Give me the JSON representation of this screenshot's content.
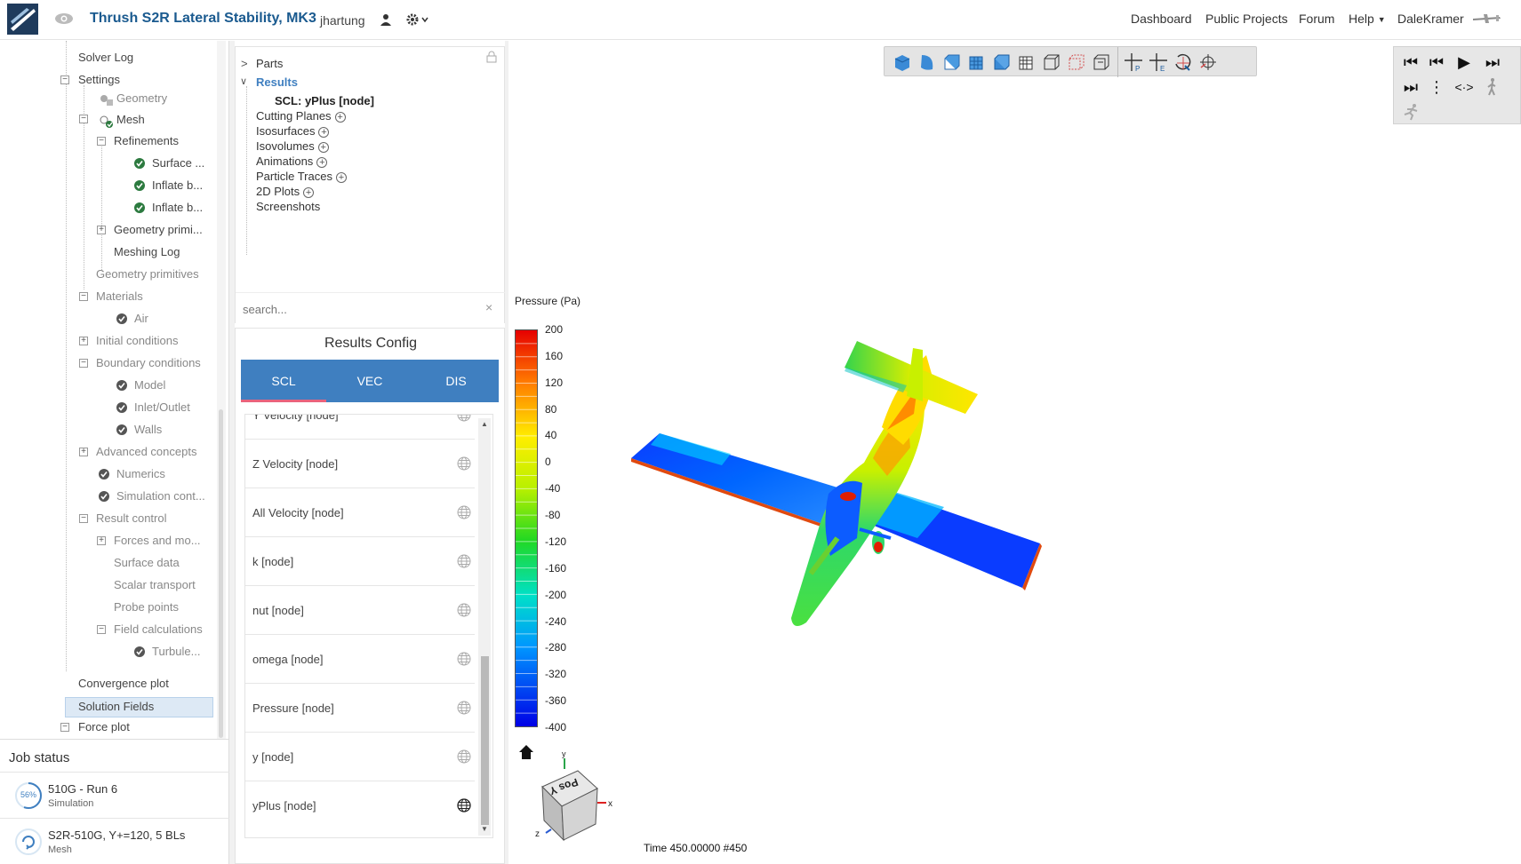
{
  "header": {
    "project_title": "Thrush S2R Lateral Stability, MK3",
    "owner": "jhartung",
    "nav": [
      "Dashboard",
      "Public Projects",
      "Forum",
      "Help"
    ],
    "user": "DaleKramer"
  },
  "tree": {
    "items": [
      {
        "label": "Solver Log"
      },
      {
        "label": "Settings"
      },
      {
        "label": "Geometry"
      },
      {
        "label": "Mesh"
      },
      {
        "label": "Refinements"
      },
      {
        "label": "Surface ..."
      },
      {
        "label": "Inflate b..."
      },
      {
        "label": "Inflate b..."
      },
      {
        "label": "Geometry primi..."
      },
      {
        "label": "Meshing Log"
      },
      {
        "label": "Geometry primitives"
      },
      {
        "label": "Materials"
      },
      {
        "label": "Air"
      },
      {
        "label": "Initial conditions"
      },
      {
        "label": "Boundary conditions"
      },
      {
        "label": "Model"
      },
      {
        "label": "Inlet/Outlet"
      },
      {
        "label": "Walls"
      },
      {
        "label": "Advanced concepts"
      },
      {
        "label": "Numerics"
      },
      {
        "label": "Simulation cont..."
      },
      {
        "label": "Result control"
      },
      {
        "label": "Forces and mo..."
      },
      {
        "label": "Surface data"
      },
      {
        "label": "Scalar transport"
      },
      {
        "label": "Probe points"
      },
      {
        "label": "Field calculations"
      },
      {
        "label": "Turbule..."
      },
      {
        "label": "Convergence plot"
      },
      {
        "label": "Solution Fields"
      },
      {
        "label": "Force plot"
      }
    ]
  },
  "job_status": {
    "title": "Job status",
    "jobs": [
      {
        "name": "510G - Run 6",
        "type": "Simulation",
        "progress": "56%"
      },
      {
        "name": "S2R-510G, Y+=120, 5 BLs",
        "type": "Mesh"
      }
    ]
  },
  "results_tree": {
    "parts": "Parts",
    "results": "Results",
    "result_item": "SCL: yPlus [node]",
    "items": [
      "Cutting Planes",
      "Isosurfaces",
      "Isovolumes",
      "Animations",
      "Particle Traces",
      "2D Plots",
      "Screenshots"
    ],
    "search_placeholder": "search..."
  },
  "results_config": {
    "title": "Results Config",
    "tabs": [
      "SCL",
      "VEC",
      "DIS"
    ],
    "fields": [
      "Y Velocity [node]",
      "Z Velocity [node]",
      "All Velocity [node]",
      "k [node]",
      "nut [node]",
      "omega [node]",
      "Pressure [node]",
      "y [node]",
      "yPlus [node]"
    ]
  },
  "viewer": {
    "legend_title": "Pressure (Pa)",
    "legend_ticks": [
      "200",
      "160",
      "120",
      "80",
      "40",
      "0",
      "-40",
      "-80",
      "-120",
      "-160",
      "-200",
      "-240",
      "-280",
      "-320",
      "-360",
      "-400"
    ],
    "time_label": "Time 450.00000  #450",
    "cube_label": "Pos Y",
    "axes": {
      "x": "x",
      "y": "y",
      "z": "z"
    }
  },
  "colors": {
    "accent": "#3f7fc0",
    "title_blue": "#1a5a8f",
    "tab_underline": "#e9637c",
    "check_green": "#2c7a3f"
  }
}
